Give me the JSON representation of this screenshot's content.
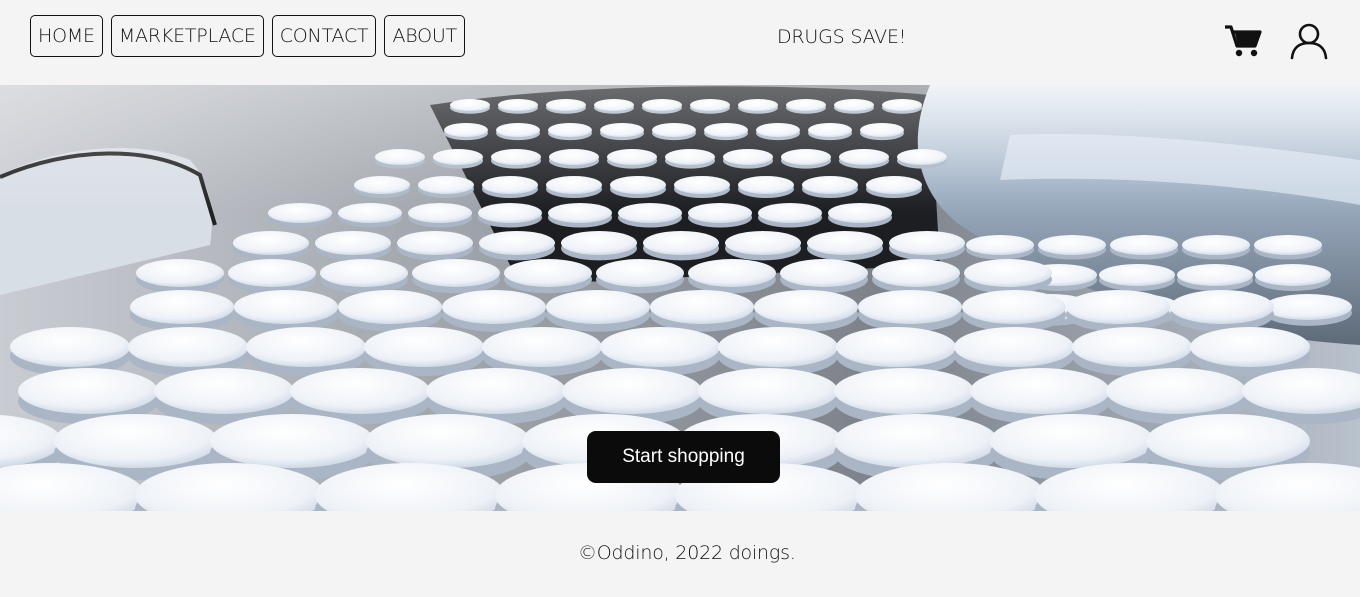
{
  "nav": {
    "items": [
      {
        "label": "HOME"
      },
      {
        "label": "MARKETPLACE"
      },
      {
        "label": "CONTACT"
      },
      {
        "label": "ABOUT"
      }
    ]
  },
  "header": {
    "brand": "DRUGS SAVE!"
  },
  "icons": {
    "cart": "cart-icon",
    "user": "user-icon"
  },
  "hero": {
    "image": "pills-conveyor-photo",
    "cta_label": "Start shopping"
  },
  "footer": {
    "text": "©Oddino, 2022 doings."
  },
  "colors": {
    "background": "#f4f4f4",
    "cta_bg": "#0b0b0b",
    "cta_text": "#ffffff",
    "text": "#111111"
  }
}
